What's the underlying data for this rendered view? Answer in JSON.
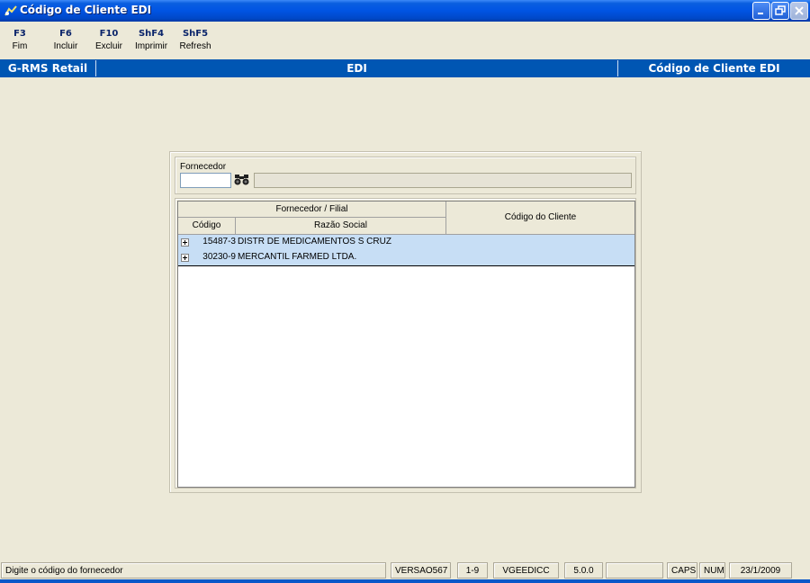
{
  "window": {
    "title": "Código de Cliente EDI"
  },
  "toolbar": {
    "items": [
      {
        "key": "F3",
        "label": "Fim"
      },
      {
        "key": "F6",
        "label": "Incluir"
      },
      {
        "key": "F10",
        "label": "Excluir"
      },
      {
        "key": "ShF4",
        "label": "Imprimir"
      },
      {
        "key": "ShF5",
        "label": "Refresh"
      }
    ]
  },
  "header": {
    "left": "G-RMS Retail",
    "center": "EDI",
    "right": "Código de Cliente EDI"
  },
  "filter": {
    "label": "Fornecedor",
    "value": "",
    "name_value": ""
  },
  "grid": {
    "group_header": "Fornecedor / Filial",
    "col_code": "Código",
    "col_name": "Razão Social",
    "col_client": "Código do Cliente",
    "rows": [
      {
        "code": "15487-3",
        "name": "DISTR DE MEDICAMENTOS S CRUZ",
        "client": ""
      },
      {
        "code": "30230-9",
        "name": "MERCANTIL FARMED LTDA.",
        "client": ""
      }
    ]
  },
  "status": {
    "message": "Digite o código do fornecedor",
    "version": "VERSAO567",
    "page": "1-9",
    "program": "VGEEDICC",
    "release": "5.0.0",
    "blank": "",
    "caps": "CAPS",
    "num": "NUM",
    "date": "23/1/2009"
  },
  "colors": {
    "titlebar": "#0054e3",
    "header": "#0056b3",
    "background": "#ece9d8",
    "row_highlight": "#c7def5",
    "fkey_text": "#0a246a"
  }
}
